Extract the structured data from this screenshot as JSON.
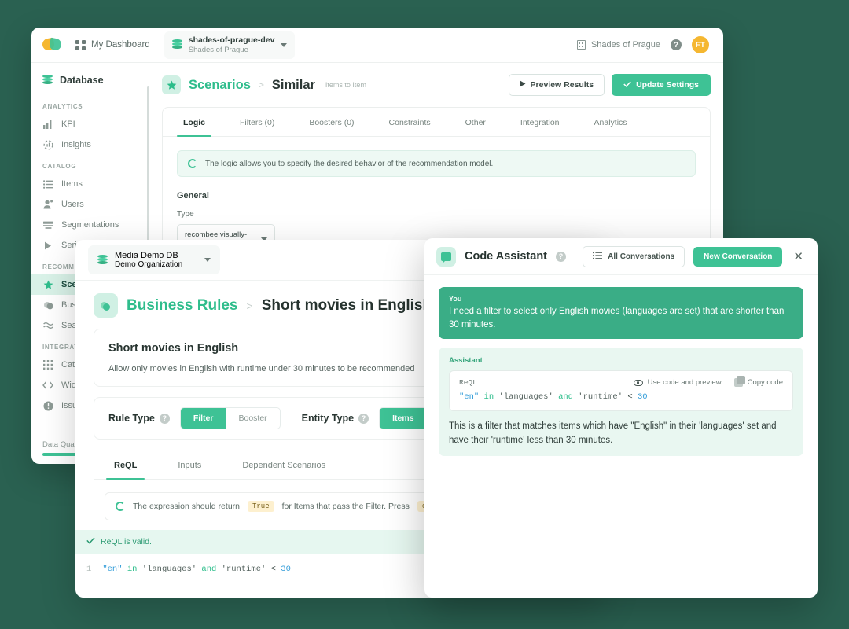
{
  "app": {
    "topbar": {
      "logo": "recombee-logo",
      "dashboard_label": "My Dashboard",
      "db_selector": {
        "name": "shades-of-prague-dev",
        "org": "Shades of Prague"
      },
      "org_label": "Shades of Prague",
      "help_label": "?",
      "avatar_initials": "FT"
    },
    "sidebar": {
      "header": "Database",
      "sections": [
        {
          "title": "ANALYTICS",
          "items": [
            {
              "label": "KPI",
              "icon": "bar-chart-icon",
              "active": false
            },
            {
              "label": "Insights",
              "icon": "insights-icon",
              "active": false
            }
          ]
        },
        {
          "title": "CATALOG",
          "items": [
            {
              "label": "Items",
              "icon": "list-icon",
              "active": false
            },
            {
              "label": "Users",
              "icon": "users-icon",
              "active": false
            },
            {
              "label": "Segmentations",
              "icon": "segmentations-icon",
              "active": false
            },
            {
              "label": "Series",
              "icon": "play-icon",
              "active": false
            }
          ]
        },
        {
          "title": "RECOMMENDATIONS",
          "items": [
            {
              "label": "Scenarios",
              "icon": "star-icon",
              "active": true
            },
            {
              "label": "Business Rules",
              "icon": "rules-icon",
              "active": false
            },
            {
              "label": "Search",
              "icon": "search-icon",
              "active": false
            }
          ]
        },
        {
          "title": "INTEGRATION",
          "items": [
            {
              "label": "Catalog Feeds",
              "icon": "grid-icon",
              "active": false
            },
            {
              "label": "Widgets",
              "icon": "code-icon",
              "active": false
            },
            {
              "label": "Issues",
              "icon": "alert-icon",
              "active": false
            }
          ]
        }
      ],
      "footer": {
        "label": "Data Quality"
      }
    },
    "main": {
      "breadcrumb": {
        "icon": "star-icon",
        "parent": "Scenarios",
        "separator": ">",
        "current": "Similar",
        "subtitle": "Items to Item"
      },
      "actions": {
        "preview": "Preview Results",
        "update": "Update Settings"
      },
      "tabs": [
        {
          "label": "Logic",
          "active": true
        },
        {
          "label": "Filters (0)",
          "active": false
        },
        {
          "label": "Boosters (0)",
          "active": false
        },
        {
          "label": "Constraints",
          "active": false
        },
        {
          "label": "Other",
          "active": false
        },
        {
          "label": "Integration",
          "active": false
        },
        {
          "label": "Analytics",
          "active": false
        }
      ],
      "info_banner": "The logic allows you to specify the desired behavior of the recommendation model.",
      "general_title": "General",
      "type_label": "Type",
      "type_value": "recombee:visually-similar"
    }
  },
  "rules_window": {
    "db_selector": {
      "name": "Media Demo DB",
      "org": "Demo Organization"
    },
    "breadcrumb": {
      "parent": "Business Rules",
      "separator": ">",
      "current": "Short movies in English"
    },
    "detail": {
      "title": "Short movies in English",
      "description": "Allow only movies in English with runtime under 30 minutes to be recommended"
    },
    "rule_type": {
      "label": "Rule Type",
      "options": [
        "Filter",
        "Booster"
      ],
      "selected": "Filter"
    },
    "entity_type": {
      "label": "Entity Type",
      "options": [
        "Items"
      ],
      "selected": "Items"
    },
    "tabs": [
      {
        "label": "ReQL",
        "active": true
      },
      {
        "label": "Inputs",
        "active": false
      },
      {
        "label": "Dependent Scenarios",
        "active": false
      }
    ],
    "hint": {
      "pre": "The expression should return",
      "badge": "True",
      "mid": "for Items that pass the Filter. Press",
      "badge2": "c"
    },
    "validation": "ReQL is valid.",
    "editor": {
      "line_no": "1",
      "tokens": [
        {
          "text": "\"en\"",
          "type": "str"
        },
        {
          "text": "in",
          "type": "kw"
        },
        {
          "text": "'languages'",
          "type": "id"
        },
        {
          "text": "and",
          "type": "kw"
        },
        {
          "text": "'runtime'",
          "type": "id"
        },
        {
          "text": "<",
          "type": "op"
        },
        {
          "text": "30",
          "type": "num"
        }
      ]
    }
  },
  "assistant": {
    "title": "Code Assistant",
    "all_conversations": "All Conversations",
    "new_conversation": "New Conversation",
    "close": "✕",
    "messages": [
      {
        "role": "You",
        "text": "I need a filter to select only English movies (languages are set) that are shorter than 30 minutes."
      },
      {
        "role": "Assistant",
        "code_lang": "ReQL",
        "use_code": "Use code and preview",
        "copy_code": "Copy code",
        "code_tokens": [
          {
            "text": "\"en\"",
            "type": "str"
          },
          {
            "text": "in",
            "type": "kw"
          },
          {
            "text": "'languages'",
            "type": "id"
          },
          {
            "text": "and",
            "type": "kw"
          },
          {
            "text": "'runtime'",
            "type": "id"
          },
          {
            "text": "<",
            "type": "op"
          },
          {
            "text": "30",
            "type": "num"
          }
        ],
        "explanation": "This is a filter that matches items which have \"English\" in their 'languages' set and have their 'runtime' less than 30 minutes."
      }
    ]
  },
  "colors": {
    "background": "#2a6151",
    "accent": "#3ec295",
    "accent_dark": "#2fbd8c",
    "accent_light": "#d0f0e4",
    "warn": "#fdf0cf",
    "avatar": "#f5b731"
  }
}
